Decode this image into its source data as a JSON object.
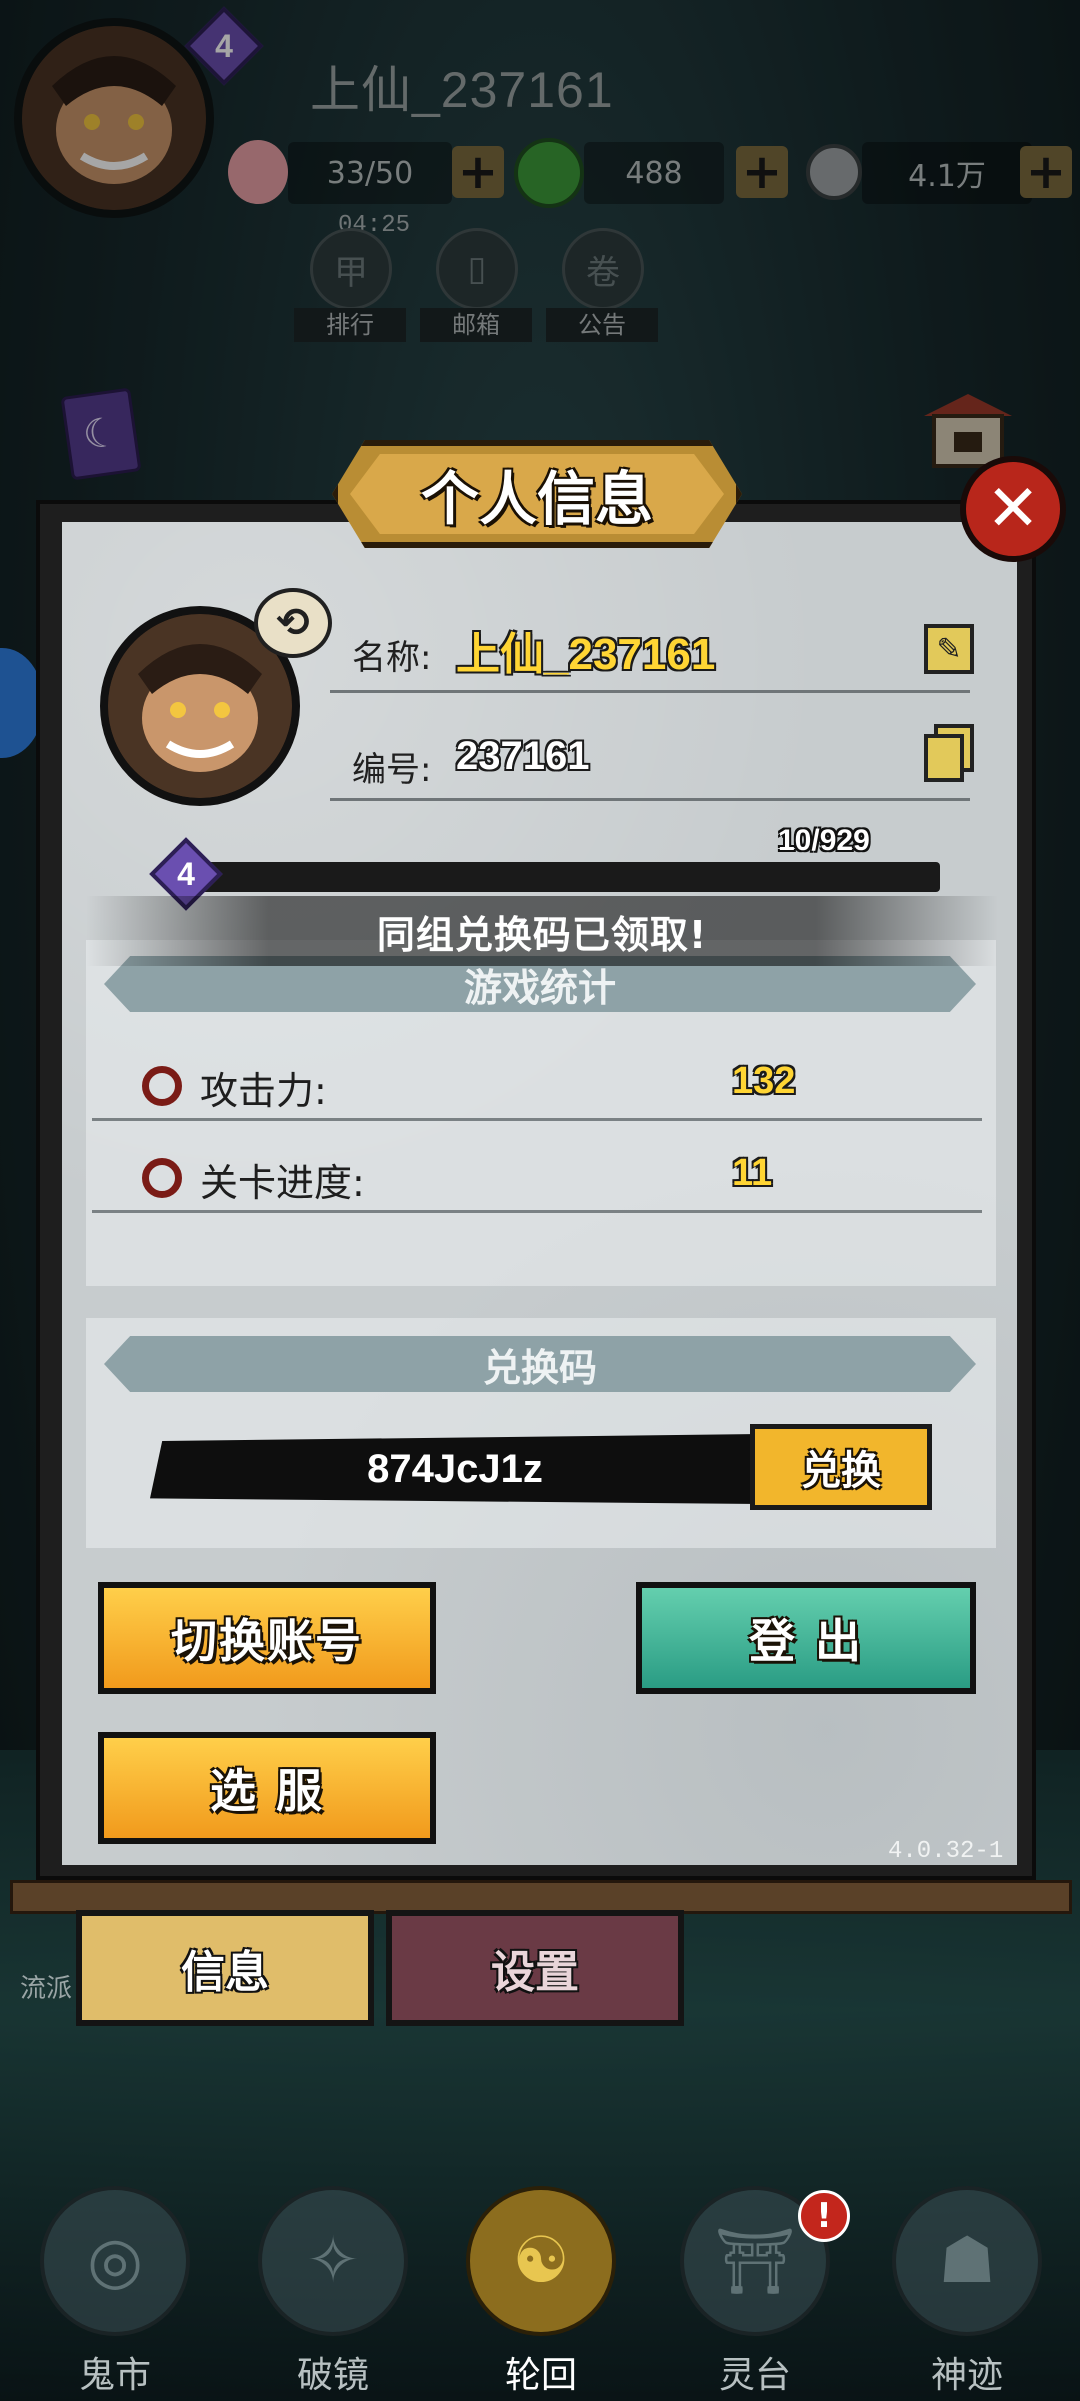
{
  "top": {
    "level": "4",
    "player_name": "上仙_237161",
    "stamina": "33/50",
    "jade": "488",
    "coins": "4.1万",
    "timer": "04:25",
    "icons": [
      {
        "name": "rank",
        "label": "排行",
        "glyph": "甲"
      },
      {
        "name": "mail",
        "label": "邮箱",
        "glyph": "▯"
      },
      {
        "name": "notice",
        "label": "公告",
        "glyph": "卷"
      }
    ]
  },
  "dialog": {
    "title": "个人信息",
    "name_label": "名称:",
    "name_value": "上仙_237161",
    "id_label": "编号:",
    "id_value": "237161",
    "level": "4",
    "xp_text": "10/929",
    "xp_fraction": 0.011,
    "toast": "同组兑换码已领取!",
    "stats_header": "游戏统计",
    "stats": [
      {
        "label": "攻击力:",
        "value": "132"
      },
      {
        "label": "关卡进度:",
        "value": "11"
      }
    ],
    "redeem_header": "兑换码",
    "redeem_code": "874JcJ1z",
    "redeem_button": "兑换",
    "switch_account": "切换账号",
    "logout": "登 出",
    "select_server": "选 服",
    "version": "4.0.32-1"
  },
  "tabs": {
    "info": "信息",
    "settings": "设置"
  },
  "side": {
    "left_text": "流派"
  },
  "nav": [
    {
      "label": "鬼市"
    },
    {
      "label": "破镜"
    },
    {
      "label": "轮回"
    },
    {
      "label": "灵台"
    },
    {
      "label": "神迹"
    }
  ],
  "nav_badge": "!"
}
